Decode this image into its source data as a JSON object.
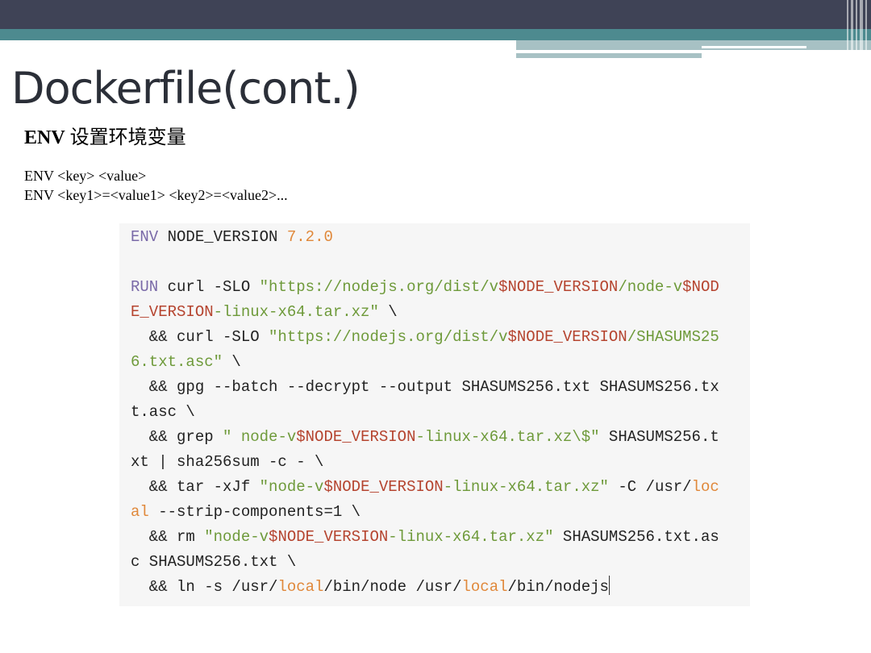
{
  "title": "Dockerfile(cont.)",
  "subtitle": {
    "keyword": "ENV",
    "desc": "设置环境变量"
  },
  "syntax": [
    "ENV <key> <value>",
    "ENV <key1>=<value1> <key2>=<value2>..."
  ],
  "colors": {
    "keyword": "#7a6aa8",
    "string": "#6e9a3a",
    "variable": "#b5442f",
    "number": "#e0883a",
    "text": "#222222"
  },
  "code_lines": [
    [
      {
        "t": "ENV",
        "c": "keyword"
      },
      {
        "t": " NODE_VERSION ",
        "c": "text"
      },
      {
        "t": "7.2.0",
        "c": "number"
      }
    ],
    [],
    [
      {
        "t": "RUN",
        "c": "keyword"
      },
      {
        "t": " curl -SLO ",
        "c": "text"
      },
      {
        "t": "\"https://nodejs.org/dist/v",
        "c": "string"
      },
      {
        "t": "$NODE_VERSION",
        "c": "variable"
      },
      {
        "t": "/node-v",
        "c": "string"
      },
      {
        "t": "$NOD",
        "c": "variable"
      }
    ],
    [
      {
        "t": "E_VERSION",
        "c": "variable"
      },
      {
        "t": "-linux-x64.tar.xz\"",
        "c": "string"
      },
      {
        "t": " \\",
        "c": "text"
      }
    ],
    [
      {
        "t": "  && curl -SLO ",
        "c": "text"
      },
      {
        "t": "\"https://nodejs.org/dist/v",
        "c": "string"
      },
      {
        "t": "$NODE_VERSION",
        "c": "variable"
      },
      {
        "t": "/SHASUMS25",
        "c": "string"
      }
    ],
    [
      {
        "t": "6.txt.asc\"",
        "c": "string"
      },
      {
        "t": " \\",
        "c": "text"
      }
    ],
    [
      {
        "t": "  && gpg --batch --decrypt --output SHASUMS256.txt SHASUMS256.tx",
        "c": "text"
      }
    ],
    [
      {
        "t": "t.asc \\",
        "c": "text"
      }
    ],
    [
      {
        "t": "  && grep ",
        "c": "text"
      },
      {
        "t": "\" node-v",
        "c": "string"
      },
      {
        "t": "$NODE_VERSION",
        "c": "variable"
      },
      {
        "t": "-linux-x64.tar.xz\\$\"",
        "c": "string"
      },
      {
        "t": " SHASUMS256.t",
        "c": "text"
      }
    ],
    [
      {
        "t": "xt | sha256sum -c - \\",
        "c": "text"
      }
    ],
    [
      {
        "t": "  && tar -xJf ",
        "c": "text"
      },
      {
        "t": "\"node-v",
        "c": "string"
      },
      {
        "t": "$NODE_VERSION",
        "c": "variable"
      },
      {
        "t": "-linux-x64.tar.xz\"",
        "c": "string"
      },
      {
        "t": " -C /usr/",
        "c": "text"
      },
      {
        "t": "loc",
        "c": "number"
      }
    ],
    [
      {
        "t": "al",
        "c": "number"
      },
      {
        "t": " --strip-components=1 \\",
        "c": "text"
      }
    ],
    [
      {
        "t": "  && rm ",
        "c": "text"
      },
      {
        "t": "\"node-v",
        "c": "string"
      },
      {
        "t": "$NODE_VERSION",
        "c": "variable"
      },
      {
        "t": "-linux-x64.tar.xz\"",
        "c": "string"
      },
      {
        "t": " SHASUMS256.txt.as",
        "c": "text"
      }
    ],
    [
      {
        "t": "c SHASUMS256.txt \\",
        "c": "text"
      }
    ],
    [
      {
        "t": "  && ln -s /usr/",
        "c": "text"
      },
      {
        "t": "local",
        "c": "number"
      },
      {
        "t": "/bin/node /usr/",
        "c": "text"
      },
      {
        "t": "local",
        "c": "number"
      },
      {
        "t": "/bin/nodejs",
        "c": "text"
      }
    ]
  ]
}
